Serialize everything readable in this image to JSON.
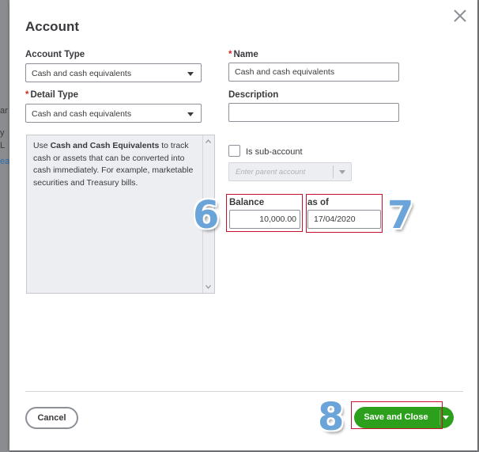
{
  "backdrop": {
    "fragments": [
      "ar",
      "y",
      "L",
      "ea"
    ]
  },
  "dialog": {
    "title": "Account",
    "account_type": {
      "label": "Account Type",
      "value": "Cash and cash equivalents"
    },
    "name": {
      "label": "Name",
      "required_mark": "*",
      "value": "Cash and cash equivalents"
    },
    "detail_type": {
      "label": "Detail Type",
      "required_mark": "*",
      "value": "Cash and cash equivalents"
    },
    "description": {
      "label": "Description",
      "value": ""
    },
    "help": {
      "prefix": "Use ",
      "bold": "Cash and Cash Equivalents",
      "suffix": " to track cash or assets that can be converted into cash immediately. For example, marketable securities and Treasury bills."
    },
    "sub_account": {
      "label": "Is sub-account",
      "checked": false,
      "parent_placeholder": "Enter parent account"
    },
    "balance": {
      "label": "Balance",
      "value": "10,000.00"
    },
    "as_of": {
      "label": "as of",
      "value": "17/04/2020"
    },
    "buttons": {
      "cancel": "Cancel",
      "save": "Save and Close"
    }
  },
  "annotations": {
    "step_balance": "6",
    "step_date": "7",
    "step_save": "8"
  },
  "colors": {
    "accent_green": "#2ca01c",
    "annotation_blue": "#6aa4d8",
    "highlight_red": "#c8102e"
  }
}
